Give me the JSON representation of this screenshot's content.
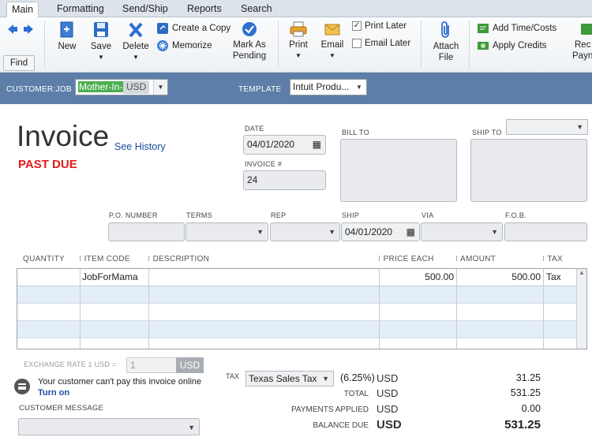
{
  "tabs": [
    "Main",
    "Formatting",
    "Send/Ship",
    "Reports",
    "Search"
  ],
  "toolbar": {
    "find": "Find",
    "new": "New",
    "save": "Save",
    "delete": "Delete",
    "create_copy": "Create a Copy",
    "memorize": "Memorize",
    "mark_pending_1": "Mark As",
    "mark_pending_2": "Pending",
    "print": "Print",
    "email": "Email",
    "print_later": "Print Later",
    "email_later": "Email Later",
    "attach_1": "Attach",
    "attach_2": "File",
    "add_time_costs": "Add Time/Costs",
    "apply_credits": "Apply Credits",
    "receive_payments_1": "Rec",
    "receive_payments_2": "Payn"
  },
  "customer": {
    "label": "CUSTOMER:JOB",
    "value": "Mother-In-L",
    "currency": "USD",
    "template_label": "TEMPLATE",
    "template_value": "Intuit Produ..."
  },
  "invoice": {
    "title": "Invoice",
    "see_history": "See History",
    "status": "PAST DUE",
    "date_label": "DATE",
    "date": "04/01/2020",
    "number_label": "INVOICE #",
    "number": "24",
    "bill_to_label": "BILL TO",
    "ship_to_label": "SHIP TO"
  },
  "fields": {
    "po_label": "P.O. NUMBER",
    "terms_label": "TERMS",
    "rep_label": "REP",
    "ship_label": "SHIP",
    "ship_date": "04/01/2020",
    "via_label": "VIA",
    "fob_label": "F.O.B."
  },
  "columns": [
    "QUANTITY",
    "ITEM CODE",
    "DESCRIPTION",
    "PRICE EACH",
    "AMOUNT",
    "TAX"
  ],
  "lines": [
    {
      "quantity": "",
      "item": "JobForMama",
      "description": "",
      "price": "500.00",
      "amount": "500.00",
      "tax": "Tax"
    }
  ],
  "footer": {
    "exchange_label": "EXCHANGE RATE 1 USD =",
    "exchange_value": "1",
    "exchange_currency": "USD",
    "online_msg": "Your customer can't pay this invoice online",
    "turn_on": "Turn on",
    "customer_message_label": "CUSTOMER MESSAGE",
    "tax_label": "TAX",
    "tax_name": "Texas Sales Tax",
    "tax_rate": "(6.25%)",
    "currency": "USD",
    "tax_amount": "31.25",
    "total_label": "TOTAL",
    "total": "531.25",
    "payments_label": "PAYMENTS APPLIED",
    "payments": "0.00",
    "balance_label": "BALANCE DUE",
    "balance": "531.25"
  },
  "colors": {
    "accent": "#1a4fa0",
    "past_due": "#e01b1b",
    "header_bar": "#5c7ea8"
  }
}
